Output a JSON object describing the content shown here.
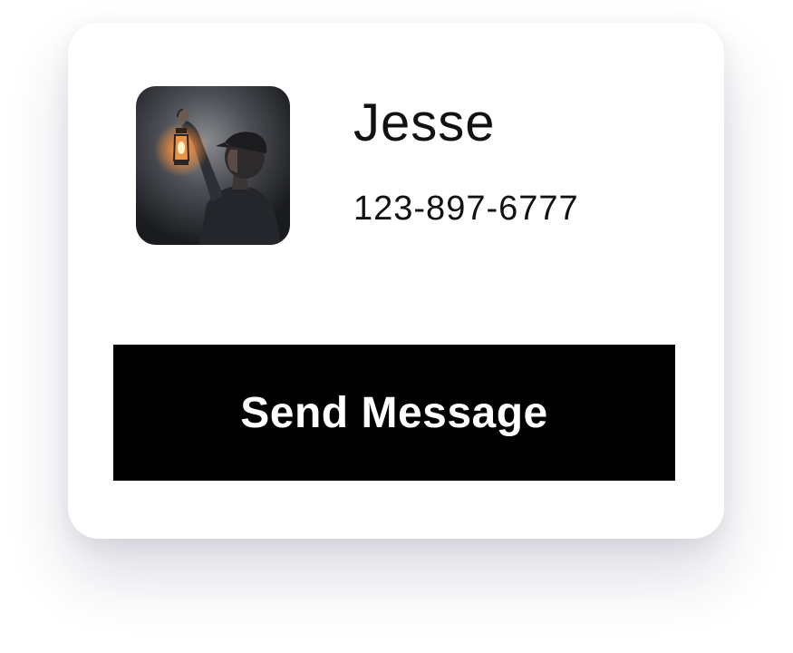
{
  "contact": {
    "name": "Jesse",
    "phone": "123-897-6777",
    "avatar_icon": "person-with-lantern-photo"
  },
  "actions": {
    "send_message_label": "Send Message"
  },
  "colors": {
    "button_bg": "#000000",
    "button_text": "#ffffff",
    "card_bg": "#ffffff",
    "text": "#111111"
  }
}
